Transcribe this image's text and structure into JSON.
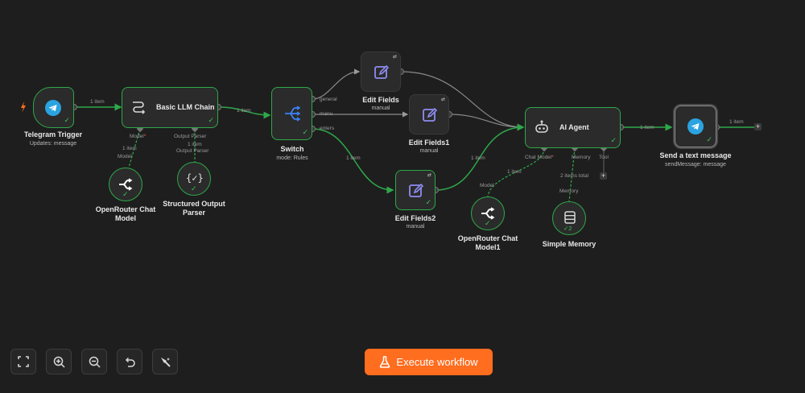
{
  "nodes": {
    "telegram_trigger": {
      "title": "Telegram Trigger",
      "subtitle": "Updates: message"
    },
    "llm_chain": {
      "title": "Basic LLM Chain",
      "port_model": "Model",
      "port_parser": "Output Parser"
    },
    "openrouter1": {
      "title": "OpenRouter Chat Model"
    },
    "parser": {
      "title": "Structured Output Parser"
    },
    "switch": {
      "title": "Switch",
      "subtitle": "mode: Rules",
      "out_general": "general",
      "out_manu": "manu",
      "out_enters": "enters"
    },
    "edit_fields": {
      "title": "Edit Fields",
      "subtitle": "manual"
    },
    "edit_fields1": {
      "title": "Edit Fields1",
      "subtitle": "manual"
    },
    "edit_fields2": {
      "title": "Edit Fields2",
      "subtitle": "manual"
    },
    "ai_agent": {
      "title": "AI Agent",
      "port_chat": "Chat Model",
      "port_memory": "Memory",
      "port_tool": "Tool"
    },
    "openrouter2": {
      "title": "OpenRouter Chat Model1"
    },
    "memory": {
      "title": "Simple Memory",
      "badge": "2"
    },
    "send_message": {
      "title": "Send a text message",
      "subtitle": "sendMessage: message"
    }
  },
  "connections": {
    "trigger_chain": "1 item",
    "chain_switch": "1 item",
    "chain_model": "1 item",
    "chain_model_port": "Model",
    "chain_parser": "1 item",
    "chain_parser_port": "Output Parser",
    "switch_edit2": "1 item",
    "edit2_agent": "1 item",
    "agent_model": "1 item",
    "agent_model_port": "Model",
    "agent_memory": "2 items total",
    "agent_memory_port": "Memory",
    "agent_send": "1 item",
    "send_out": "1 item"
  },
  "toolbar": {
    "execute_label": "Execute workflow",
    "icons": [
      "fit-view-icon",
      "zoom-in-icon",
      "zoom-out-icon",
      "undo-icon",
      "tidy-up-icon"
    ]
  },
  "colors": {
    "background": "#1e1e1e",
    "node": "#2b2b2b",
    "success": "#2ea84a",
    "accent": "#ff6d1f",
    "telegram": "#2aa3e0",
    "edit_icon": "#8e8cf2"
  }
}
